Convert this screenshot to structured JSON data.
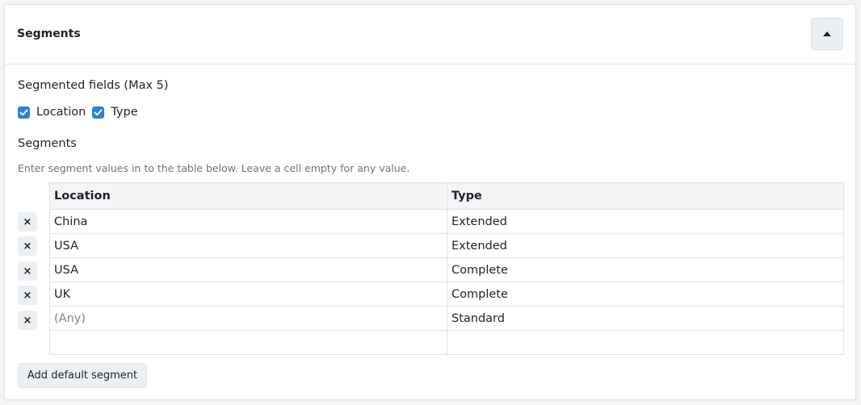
{
  "panel": {
    "title": "Segments",
    "collapse_icon": "caret-up-icon"
  },
  "fields_section": {
    "label": "Segmented fields (Max 5)",
    "options": [
      {
        "label": "Location",
        "checked": true
      },
      {
        "label": "Type",
        "checked": true
      }
    ]
  },
  "segments_section": {
    "label": "Segments",
    "hint": "Enter segment values in to the table below. Leave a cell empty for any value.",
    "columns": [
      "Location",
      "Type"
    ],
    "rows": [
      {
        "location": "China",
        "type": "Extended"
      },
      {
        "location": "USA",
        "type": "Extended"
      },
      {
        "location": "USA",
        "type": "Complete"
      },
      {
        "location": "UK",
        "type": "Complete"
      },
      {
        "location": "(Any)",
        "type": "Standard"
      }
    ],
    "empty_row": {
      "location": "",
      "type": ""
    },
    "delete_icon": "close-icon",
    "delete_glyph": "×"
  },
  "add_button": {
    "label": "Add default segment"
  },
  "colors": {
    "checkbox": "#2f80d6",
    "placeholder_text": "#7a8490"
  }
}
